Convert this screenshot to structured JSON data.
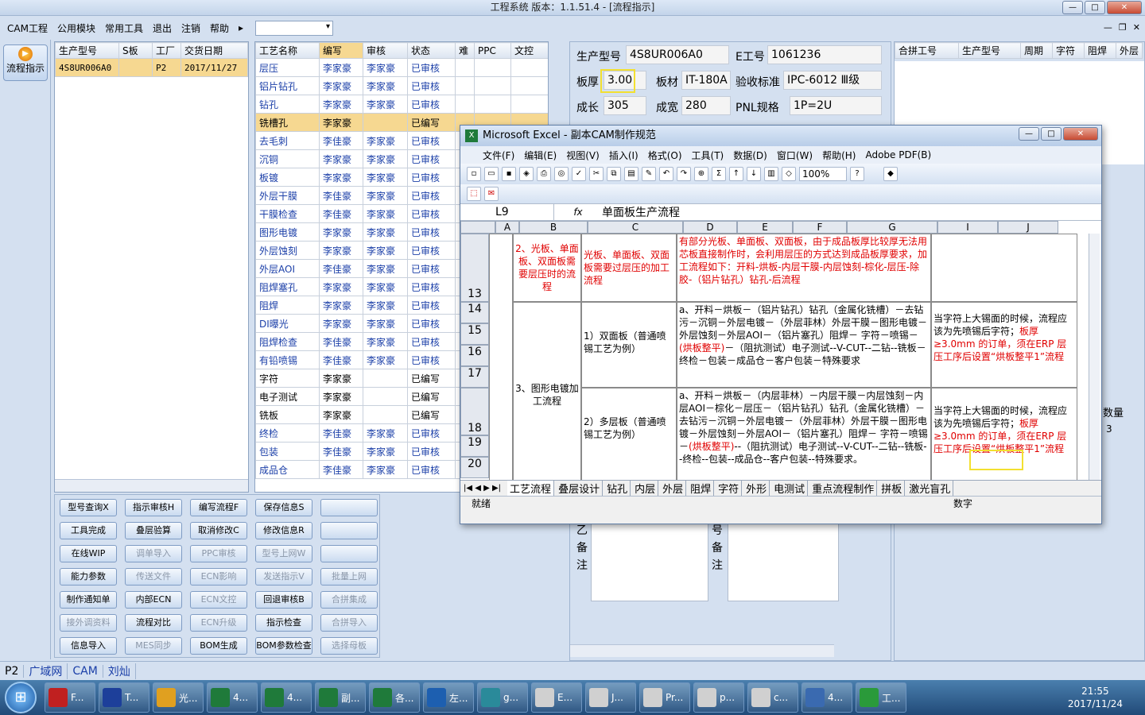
{
  "app": {
    "title": "工程系统  版本：1.1.51.4 - [流程指示]"
  },
  "menu": {
    "items": [
      "CAM工程",
      "公用模块",
      "常用工具",
      "退出",
      "注销",
      "帮助"
    ]
  },
  "left": {
    "flow_button": "流程指示"
  },
  "model_table": {
    "headers": [
      "生产型号",
      "S板",
      "工厂",
      "交货日期"
    ],
    "rows": [
      [
        "4S8UR006A0",
        "",
        "P2",
        "2017/11/27"
      ]
    ]
  },
  "process_table": {
    "headers": [
      "工艺名称",
      "编写",
      "审核",
      "状态",
      "难",
      "PPC",
      "文控"
    ],
    "rows": [
      [
        "层压",
        "李家豪",
        "李家豪",
        "已审核"
      ],
      [
        "铝片钻孔",
        "李家豪",
        "李家豪",
        "已审核"
      ],
      [
        "钻孔",
        "李家豪",
        "李家豪",
        "已审核"
      ],
      [
        "铣槽孔",
        "李家豪",
        "",
        "已编写"
      ],
      [
        "去毛刺",
        "李佳豪",
        "李家豪",
        "已审核"
      ],
      [
        "沉铜",
        "李家豪",
        "李家豪",
        "已审核"
      ],
      [
        "板镀",
        "李家豪",
        "李家豪",
        "已审核"
      ],
      [
        "外层干膜",
        "李佳豪",
        "李家豪",
        "已审核"
      ],
      [
        "干膜检查",
        "李佳豪",
        "李家豪",
        "已审核"
      ],
      [
        "图形电镀",
        "李家豪",
        "李家豪",
        "已审核"
      ],
      [
        "外层蚀刻",
        "李家豪",
        "李家豪",
        "已审核"
      ],
      [
        "外层AOI",
        "李佳豪",
        "李家豪",
        "已审核"
      ],
      [
        "阻焊塞孔",
        "李家豪",
        "李家豪",
        "已审核"
      ],
      [
        "阻焊",
        "李家豪",
        "李家豪",
        "已审核"
      ],
      [
        "DI曝光",
        "李家豪",
        "李家豪",
        "已审核"
      ],
      [
        "阻焊检查",
        "李佳豪",
        "李家豪",
        "已审核"
      ],
      [
        "有铅喷锡",
        "李佳豪",
        "李家豪",
        "已审核"
      ],
      [
        "字符",
        "李家豪",
        "",
        "已编写"
      ],
      [
        "电子测试",
        "李家豪",
        "",
        "已编写"
      ],
      [
        "铣板",
        "李家豪",
        "",
        "已编写"
      ],
      [
        "终检",
        "李佳豪",
        "李家豪",
        "已审核"
      ],
      [
        "包装",
        "李佳豪",
        "李家豪",
        "已审核"
      ],
      [
        "成品仓",
        "李佳豪",
        "李家豪",
        "已审核"
      ]
    ]
  },
  "buttons": [
    [
      "型号查询X",
      "指示审核H",
      "编写流程F",
      "保存信息S",
      ""
    ],
    [
      "工具完成",
      "叠层验算",
      "取消修改C",
      "修改信息R",
      ""
    ],
    [
      "在线WIP",
      "调单导入",
      "PPC审核",
      "型号上网W",
      ""
    ],
    [
      "能力参数",
      "传送文件",
      "ECN影响",
      "发送指示V",
      "批量上网"
    ],
    [
      "制作通知单",
      "内部ECN",
      "ECN文控",
      "回退审核B",
      "合拼集成"
    ],
    [
      "接外调资料",
      "流程对比",
      "ECN升级",
      "指示检查",
      "合拼导入"
    ],
    [
      "信息导入",
      "MES同步",
      "BOM生成",
      "BOM参数检查",
      "选择母板"
    ]
  ],
  "info": {
    "model_label": "生产型号",
    "model": "4S8UR006A0",
    "eno_label": "E工号",
    "eno": "1061236",
    "thick_label": "板厚",
    "thick": "3.00",
    "mat_label": "板材",
    "mat": "IT-180A",
    "std_label": "验收标准",
    "std": "IPC-6012 Ⅲ级",
    "len_label": "成长",
    "len": "305",
    "wid_label": "成宽",
    "wid": "280",
    "pnl_label": "PNL规格",
    "pnl": "1P=2U",
    "note1": "乙备注",
    "note2": "号备注"
  },
  "right": {
    "headers": [
      "合拼工号",
      "生产型号",
      "周期",
      "字符",
      "阻焊",
      "外层"
    ],
    "qty_label": "数量",
    "qty": "3"
  },
  "excel": {
    "title": "Microsoft Excel - 副本CAM制作规范",
    "menu": [
      "文件(F)",
      "编辑(E)",
      "视图(V)",
      "插入(I)",
      "格式(O)",
      "工具(T)",
      "数据(D)",
      "窗口(W)",
      "帮助(H)",
      "Adobe PDF(B)"
    ],
    "zoom": "100%",
    "cellref": "L9",
    "formula": "单面板生产流程",
    "cols": [
      "A",
      "B",
      "C",
      "D",
      "E",
      "F",
      "G",
      "I",
      "J"
    ],
    "rows": [
      "13",
      "14",
      "15",
      "16",
      "17",
      "18",
      "19",
      "20"
    ],
    "b13": "2、光板、单面板、双面板需要层压时的流程",
    "c13": "光板、单面板、双面板需要过层压的加工流程",
    "d13": "有部分光板、单面板、双面板，由于成品板厚比较厚无法用芯板直接制作时，会利用层压的方式达到成品板厚要求，加工流程如下：开料-烘板-内层干膜-内层蚀刻-棕化-层压-除胶-（铝片钻孔）钻孔-后流程",
    "b14": "3、图形电镀加工流程",
    "c14": "1）双面板（普通喷锡工艺为例）",
    "d14a": "a、开料－烘板－（铝片钻孔）钻孔（金属化铣槽）－去钻污－沉铜－外层电镀－（外层菲林）外层干膜－图形电镀－外层蚀刻－外层AOI－（铝片塞孔）阻焊－ 字符－喷锡－",
    "d14red": "(烘板整平)",
    "d14b": "－（阻抗测试）电子测试--V-CUT--二钻--铣板－终检－包装－成品仓－客户包装－特殊要求",
    "i14a": "当字符上大锡面的时候，流程应该为先喷锡后字符；",
    "i14red": "板厚≥3.0mm 的订单，须在ERP 层压工序后设置“烘板整平1”流程",
    "c18": "2）多层板（普通喷锡工艺为例）",
    "d18a": "a、开料－烘板－（内层菲林）－内层干膜－内层蚀刻－内层AOI－棕化－层压－（铝片钻孔）钻孔（金属化铣槽）－去钻污－沉铜－外层电镀－（外层菲林）外层干膜－图形电镀－外层蚀刻－外层AOI－（铝片塞孔）阻焊－ 字符－喷锡－",
    "d18red": "(烘板整平)",
    "d18b": "--（阻抗测试）电子测试--V-CUT--二钻--铣板--终检--包装--成品仓--客户包装--特殊要求。",
    "i18a": "当字符上大锡面的时候，流程应该为先喷锡后字符；",
    "i18red": "板厚≥3.0mm 的订单，须在ERP 层压工序后设置“烘板整平1”流程",
    "tabs": [
      "工艺流程",
      "叠层设计",
      "钻孔",
      "内层",
      "外层",
      "阻焊",
      "字符",
      "外形",
      "电测试",
      "重点流程制作",
      "拼板",
      "激光盲孔"
    ],
    "status": "就绪",
    "status_right": "数字"
  },
  "bottom": {
    "items": [
      "P2",
      "广域网",
      "CAM",
      "刘灿"
    ]
  },
  "taskbar": {
    "buttons": [
      "F...",
      "T...",
      "光...",
      "4...",
      "4...",
      "副...",
      "各...",
      "左...",
      "g...",
      "E...",
      "J...",
      "Pr...",
      "p...",
      "c...",
      "4...",
      "工..."
    ],
    "time": "21:55",
    "date": "2017/11/24"
  },
  "colors": {
    "accent": "#f3e030",
    "red": "#e00000",
    "blue": "#1b3fa8"
  }
}
